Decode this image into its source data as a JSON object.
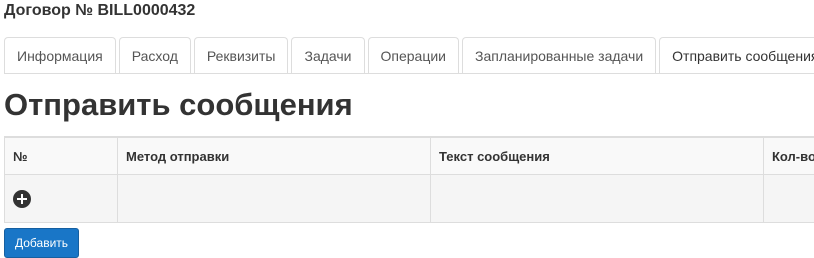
{
  "contract": {
    "title": "Договор № BILL0000432"
  },
  "tabs": [
    {
      "label": "Информация",
      "active": false
    },
    {
      "label": "Расход",
      "active": false
    },
    {
      "label": "Реквизиты",
      "active": false
    },
    {
      "label": "Задачи",
      "active": false
    },
    {
      "label": "Операции",
      "active": false
    },
    {
      "label": "Запланированные задачи",
      "active": false
    },
    {
      "label": "Отправить сообщения",
      "active": true
    }
  ],
  "section": {
    "heading": "Отправить сообщения"
  },
  "table": {
    "columns": [
      "№",
      "Метод отправки",
      "Текст сообщения",
      "Кол-во"
    ],
    "add_row_icon": "plus-circle-icon"
  },
  "actions": {
    "add_label": "Добавить"
  },
  "colors": {
    "primary_button": "#1976c7",
    "text": "#333333",
    "border": "#dddddd"
  }
}
